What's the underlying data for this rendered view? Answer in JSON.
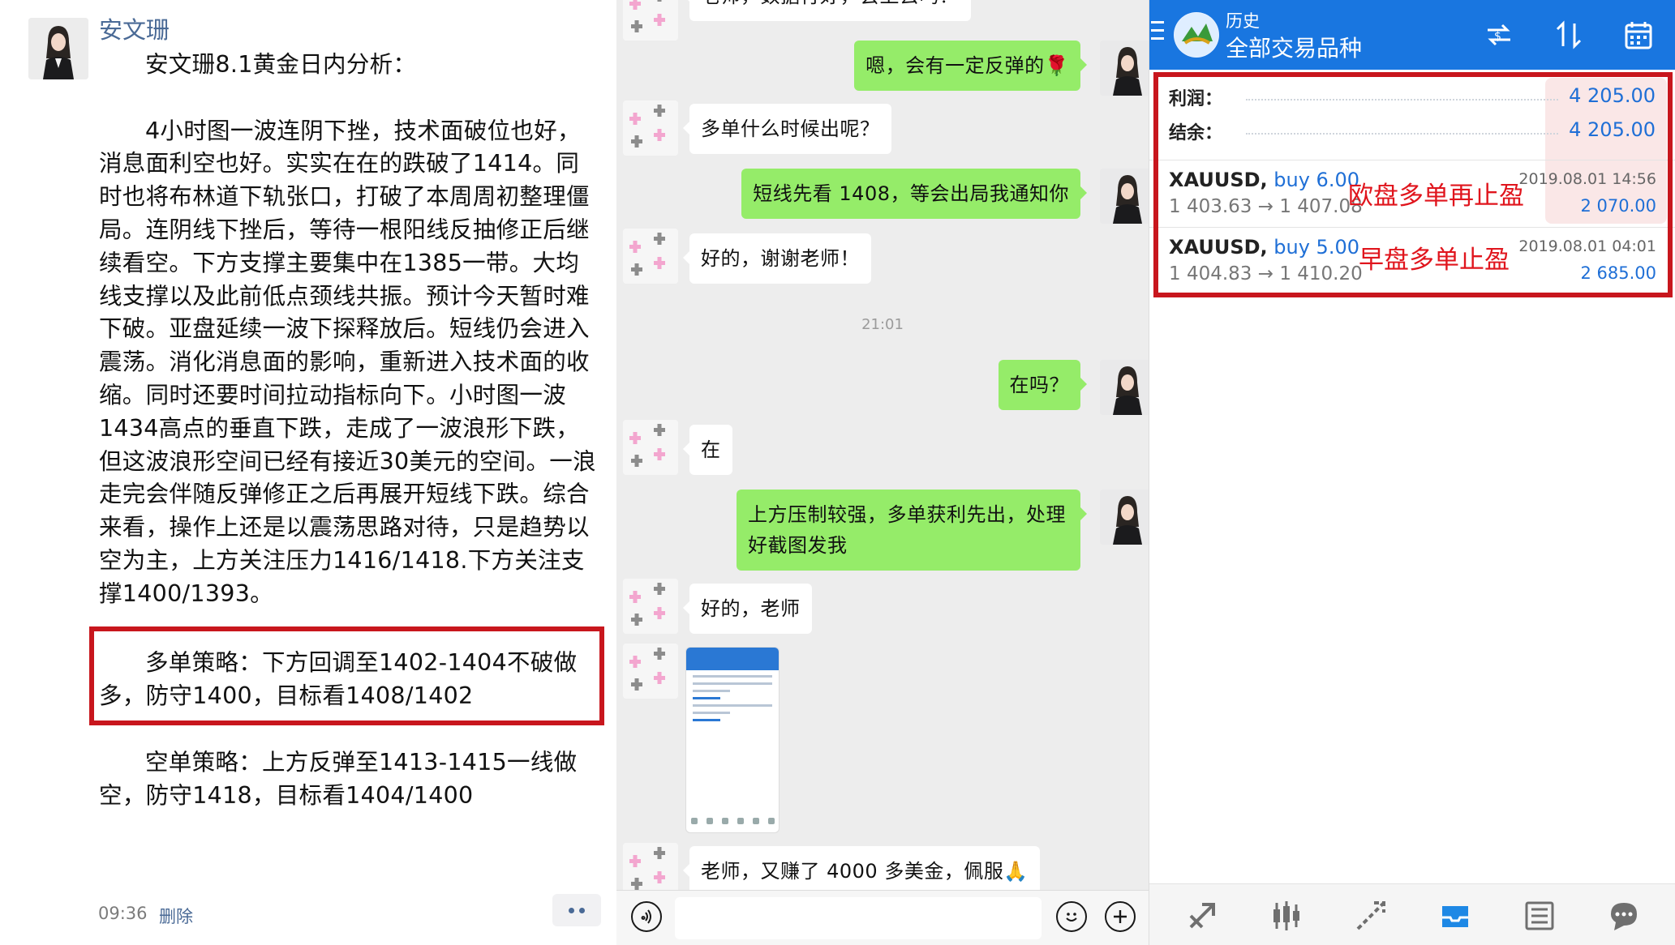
{
  "post": {
    "author": "安文珊",
    "title": "安文珊8.1黄金日内分析：",
    "body": "4小时图一波连阴下挫，技术面破位也好，消息面利空也好。实实在在的跌破了1414。同时也将布林道下轨张口，打破了本周周初整理僵局。连阴线下挫后，等待一根阳线反抽修正后继续看空。下方支撑主要集中在1385一带。大均线支撑以及此前低点颈线共振。预计今天暂时难下破。亚盘延续一波下探释放后。短线仍会进入震荡。消化消息面的影响，重新进入技术面的收缩。同时还要时间拉动指标向下。小时图一波1434高点的垂直下跌，走成了一波浪形下跌，但这波浪形空间已经有接近30美元的空间。一浪走完会伴随反弹修正之后再展开短线下跌。综合来看，操作上还是以震荡思路对待，只是趋势以空为主，上方关注压力1416/1418.下方关注支撑1400/1393。",
    "long_strategy": "多单策略：下方回调至1402-1404不破做多，防守1400，目标看1408/1402",
    "short_strategy": "空单策略：上方反弹至1413-1415一线做空，防守1418，目标看1404/1400",
    "time": "09:36",
    "delete_label": "删除"
  },
  "chat": {
    "messages": [
      {
        "side": "left",
        "text": "老师，数据行好，会上去吗？"
      },
      {
        "side": "right",
        "text": "嗯，会有一定反弹的🌹"
      },
      {
        "side": "left",
        "text": "多单什么时候出呢？"
      },
      {
        "side": "right",
        "text": "短线先看 1408，等会出局我通知你"
      },
      {
        "side": "left",
        "text": "好的，谢谢老师！"
      },
      {
        "side": "right",
        "text": "在吗？"
      },
      {
        "side": "left",
        "text": "在"
      },
      {
        "side": "right",
        "text": "上方压制较强，多单获利先出，处理好截图发我"
      },
      {
        "side": "left",
        "text": "好的，老师"
      },
      {
        "side": "left",
        "text": "老师，又赚了 4000 多美金，佩服🙏"
      }
    ],
    "timestamp": "21:01"
  },
  "mt4": {
    "title_small": "历史",
    "title_main": "全部交易品种",
    "profit_label": "利润：",
    "profit_value": "4 205.00",
    "balance_label": "结余：",
    "balance_value": "4 205.00",
    "trades": [
      {
        "symbol": "XAUUSD,",
        "side": "buy 6.00",
        "prices": "1 403.63 → 1 407.08",
        "datetime": "2019.08.01 14:56",
        "profit": "2 070.00",
        "note": "欧盘多单再止盈"
      },
      {
        "symbol": "XAUUSD,",
        "side": "buy 5.00",
        "prices": "1 404.83 → 1 410.20",
        "datetime": "2019.08.01 04:01",
        "profit": "2 685.00",
        "note": "早盘多单止盈"
      }
    ],
    "colors": {
      "accent": "#1976e0",
      "value": "#1f6fd6",
      "annotation": "#e0151d",
      "highlight_box": "#c8161d"
    }
  }
}
